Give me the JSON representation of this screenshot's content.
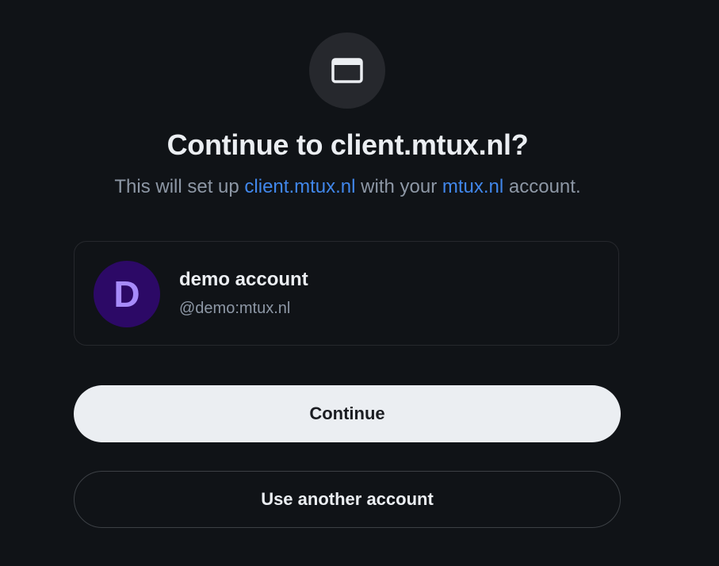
{
  "consent": {
    "app_icon": "window-icon",
    "title": "Continue to client.mtux.nl?",
    "subtitle": {
      "prefix": "This will set up ",
      "client_link": "client.mtux.nl",
      "middle": " with your ",
      "server_link": "mtux.nl",
      "suffix": " account."
    }
  },
  "account": {
    "avatar_letter": "D",
    "display_name": "demo account",
    "user_id": "@demo:mtux.nl"
  },
  "actions": {
    "continue_label": "Continue",
    "switch_label": "Use another account"
  },
  "colors": {
    "background": "#101317",
    "link": "#4187eb",
    "avatar_bg": "#2c0966",
    "avatar_fg": "#a78bfa",
    "primary_button_bg": "#ebeef2"
  }
}
